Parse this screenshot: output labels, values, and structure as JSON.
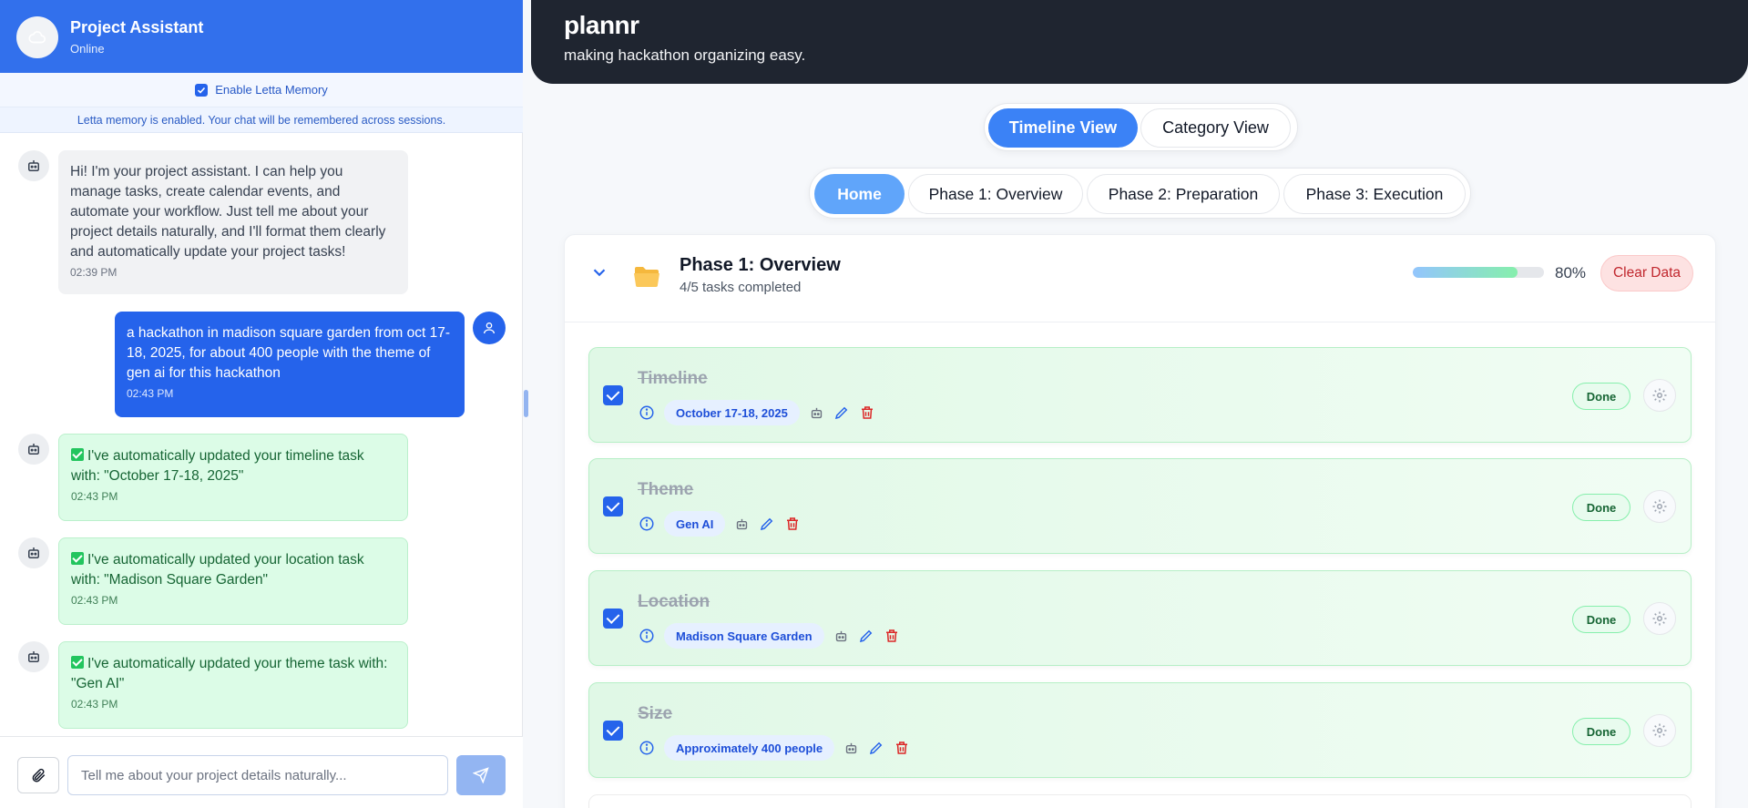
{
  "chat": {
    "title": "Project Assistant",
    "status": "Online",
    "memory_toggle_label": "Enable Letta Memory",
    "memory_note": "Letta memory is enabled. Your chat will be remembered across sessions.",
    "messages": [
      {
        "role": "assistant",
        "text": "Hi! I'm your project assistant. I can help you manage tasks, create calendar events, and automate your workflow. Just tell me about your project details naturally, and I'll format them clearly and automatically update your project tasks!",
        "time": "02:39 PM"
      },
      {
        "role": "user",
        "text": "a hackathon in madison square garden from oct 17-18, 2025, for about 400 people with the theme of gen ai for this hackathon",
        "time": "02:43 PM"
      },
      {
        "role": "assistant",
        "text": "I've automatically updated your timeline task with: \"October 17-18, 2025\"",
        "time": "02:43 PM"
      },
      {
        "role": "assistant",
        "text": "I've automatically updated your location task with: \"Madison Square Garden\"",
        "time": "02:43 PM"
      },
      {
        "role": "assistant",
        "text": "I've automatically updated your theme task with: \"Gen AI\"",
        "time": "02:43 PM"
      }
    ],
    "input_placeholder": "Tell me about your project details naturally..."
  },
  "header": {
    "brand": "plannr",
    "tagline": "making hackathon organizing easy."
  },
  "view_toggle": {
    "active": "Timeline View",
    "inactive": "Category View"
  },
  "phase_nav": [
    "Home",
    "Phase 1: Overview",
    "Phase 2: Preparation",
    "Phase 3: Execution"
  ],
  "phase": {
    "title": "Phase 1: Overview",
    "subtitle": "4/5 tasks completed",
    "progress_percent": 80,
    "progress_label": "80%",
    "clear_label": "Clear Data"
  },
  "tasks": [
    {
      "name": "Timeline",
      "value": "October 17-18, 2025",
      "status": "Done"
    },
    {
      "name": "Theme",
      "value": "Gen AI",
      "status": "Done"
    },
    {
      "name": "Location",
      "value": "Madison Square Garden",
      "status": "Done"
    },
    {
      "name": "Size",
      "value": "Approximately 400 people",
      "status": "Done"
    }
  ],
  "colors": {
    "chat_header": "#3270ec",
    "topbar": "#1f2530",
    "accent": "#3b82f6",
    "success": "#22c55e",
    "danger": "#dc2626"
  }
}
